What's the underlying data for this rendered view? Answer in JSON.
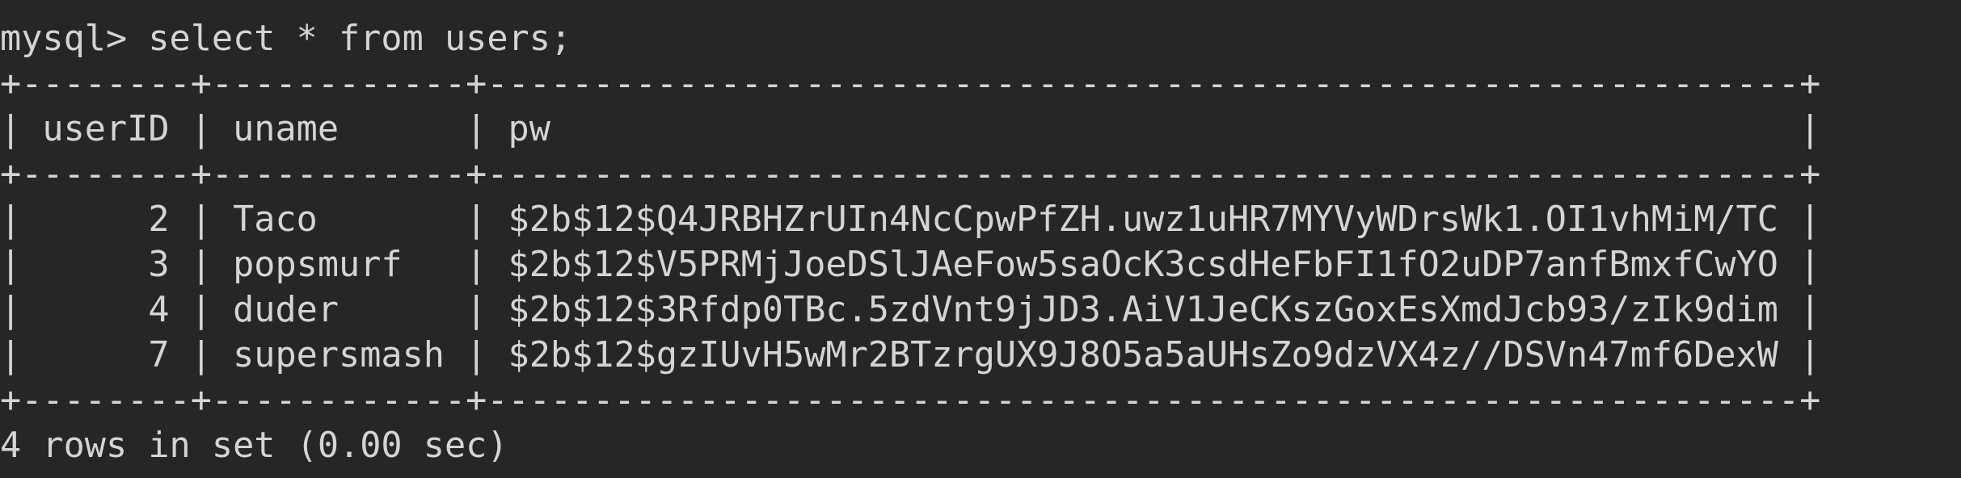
{
  "terminal": {
    "prompt": "mysql>",
    "command": "select * from users;",
    "query_line": "mysql> select * from users;",
    "border_top": "+--------+------------+--------------------------------------------------------------+",
    "header_row": "| userID | uname      | pw                                                           |",
    "border_mid": "+--------+------------+--------------------------------------------------------------+",
    "rows": [
      "|      2 | Taco       | $2b$12$Q4JRBHZrUIn4NcCpwPfZH.uwz1uHR7MYVyWDrsWk1.OI1vhMiM/TC |",
      "|      3 | popsmurf   | $2b$12$V5PRMjJoeDSlJAeFow5saOcK3csdHeFbFI1fO2uDP7anfBmxfCwYO |",
      "|      4 | duder      | $2b$12$3Rfdp0TBc.5zdVnt9jJD3.AiV1JeCKszGoxEsXmdJcb93/zIk9dim |",
      "|      7 | supersmash | $2b$12$gzIUvH5wMr2BTzrgUX9J8O5a5aUHsZo9dzVX4z//DSVn47mf6DexW |"
    ],
    "border_bottom": "+--------+------------+--------------------------------------------------------------+",
    "result_summary": "4 rows in set (0.00 sec)"
  },
  "table": {
    "columns": [
      "userID",
      "uname",
      "pw"
    ],
    "records": [
      {
        "userID": "2",
        "uname": "Taco",
        "pw": "$2b$12$Q4JRBHZrUIn4NcCpwPfZH.uwz1uHR7MYVyWDrsWk1.OI1vhMiM/TC"
      },
      {
        "userID": "3",
        "uname": "popsmurf",
        "pw": "$2b$12$V5PRMjJoeDSlJAeFow5saOcK3csdHeFbFI1fO2uDP7anfBmxfCwYO"
      },
      {
        "userID": "4",
        "uname": "duder",
        "pw": "$2b$12$3Rfdp0TBc.5zdVnt9jJD3.AiV1JeCKszGoxEsXmdJcb93/zIk9dim"
      },
      {
        "userID": "7",
        "uname": "supersmash",
        "pw": "$2b$12$gzIUvH5wMr2BTzrgUX9J8O5a5aUHsZo9dzVX4z//DSVn47mf6DexW"
      }
    ]
  },
  "colors": {
    "background": "#262626",
    "foreground": "#d4d4d4"
  }
}
